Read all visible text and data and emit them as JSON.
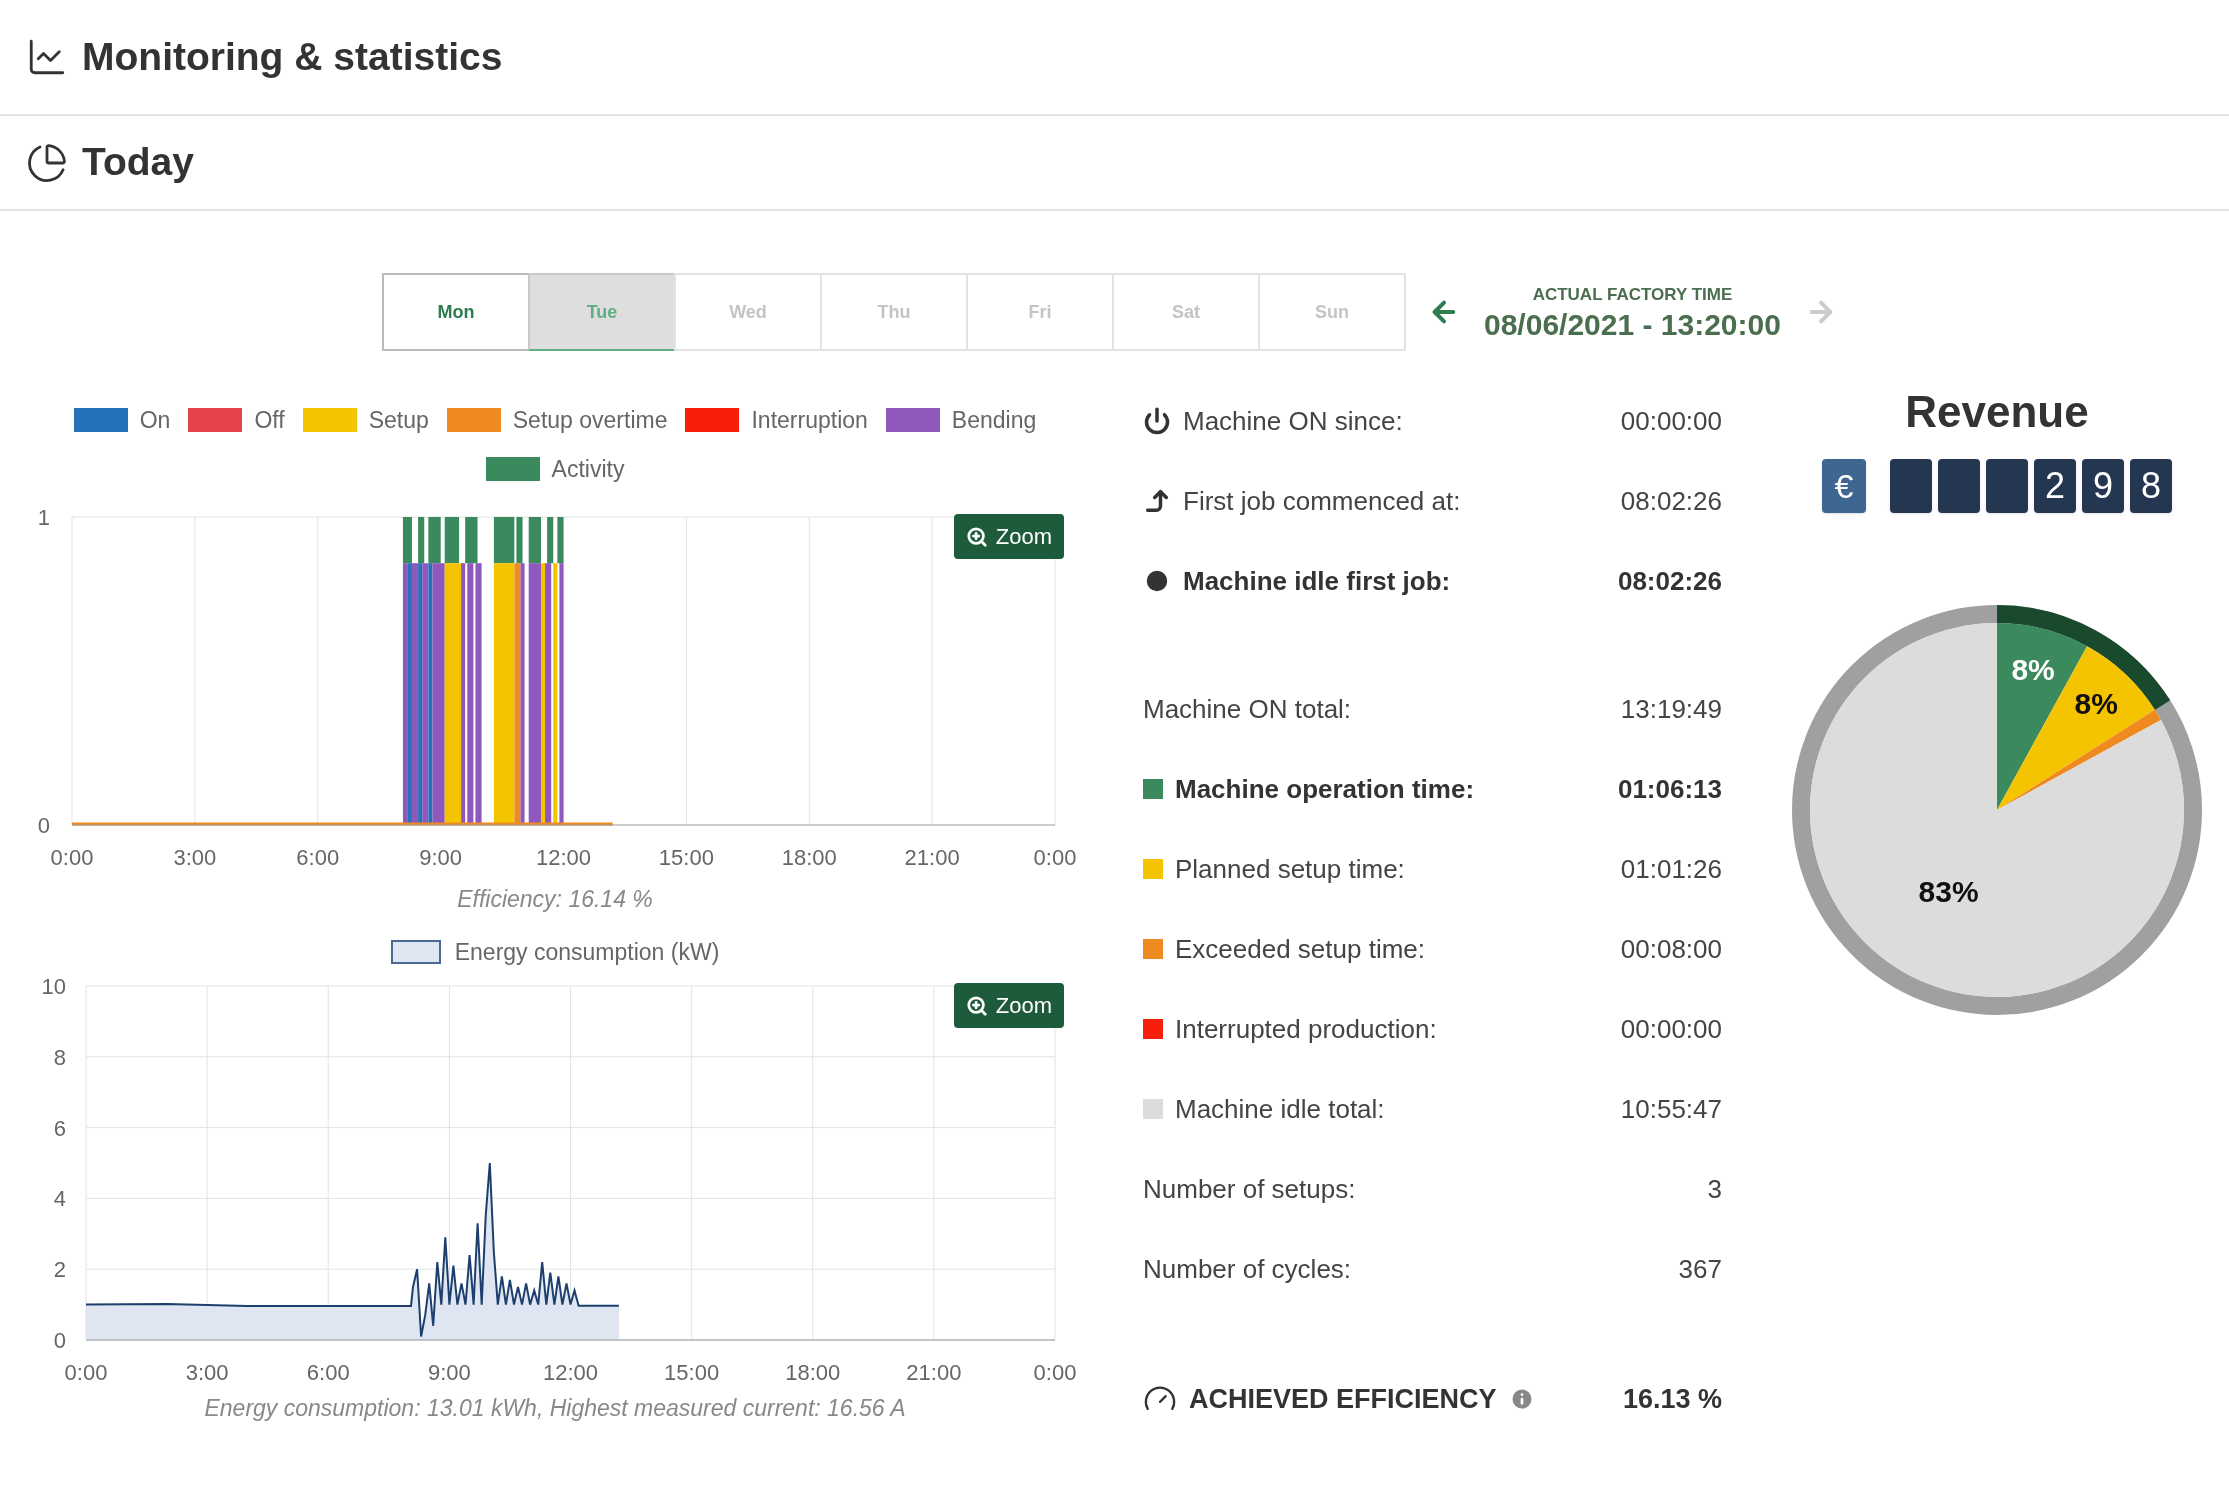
{
  "header": {
    "title": "Monitoring & statistics"
  },
  "section": {
    "title": "Today"
  },
  "days": [
    {
      "label": "Mon",
      "selected": false,
      "disabled": false
    },
    {
      "label": "Tue",
      "selected": true,
      "disabled": false
    },
    {
      "label": "Wed",
      "selected": false,
      "disabled": true
    },
    {
      "label": "Thu",
      "selected": false,
      "disabled": true
    },
    {
      "label": "Fri",
      "selected": false,
      "disabled": true
    },
    {
      "label": "Sat",
      "selected": false,
      "disabled": true
    },
    {
      "label": "Sun",
      "selected": false,
      "disabled": true
    }
  ],
  "factory_time": {
    "label": "ACTUAL FACTORY TIME",
    "value": "08/06/2021 - 13:20:00",
    "prev_disabled": false,
    "next_disabled": true
  },
  "state_chart": {
    "legend": [
      {
        "label": "On",
        "color": "#2473b8"
      },
      {
        "label": "Off",
        "color": "#e5434b"
      },
      {
        "label": "Setup",
        "color": "#f5c400"
      },
      {
        "label": "Setup overtime",
        "color": "#ee8a1f"
      },
      {
        "label": "Interruption",
        "color": "#f71f0b"
      },
      {
        "label": "Bending",
        "color": "#8e58bd"
      },
      {
        "label": "Activity",
        "color": "#3a8a5e"
      }
    ],
    "y_ticks": [
      "1",
      "0"
    ],
    "x_ticks": [
      "0:00",
      "3:00",
      "6:00",
      "9:00",
      "12:00",
      "15:00",
      "18:00",
      "21:00",
      "0:00"
    ],
    "zoom_button": "Zoom",
    "caption": "Efficiency: 16.14 %"
  },
  "energy_chart": {
    "zoom_button": "Zoom",
    "caption": "Energy consumption: 13.01 kWh, Highest measured current: 16.56 A",
    "chart_data": {
      "type": "area",
      "x": [
        0,
        2,
        4,
        8.05,
        8.1,
        8.2,
        8.3,
        8.4,
        8.5,
        8.6,
        8.7,
        8.8,
        8.9,
        9.0,
        9.1,
        9.2,
        9.3,
        9.4,
        9.5,
        9.6,
        9.7,
        9.8,
        9.9,
        10.0,
        10.1,
        10.2,
        10.3,
        10.4,
        10.5,
        10.6,
        10.7,
        10.8,
        10.9,
        11.0,
        11.1,
        11.2,
        11.3,
        11.4,
        11.5,
        11.6,
        11.7,
        11.8,
        11.9,
        12.0,
        12.1,
        12.2,
        13.2
      ],
      "series": [
        {
          "name": "Energy consumption (kW)",
          "color": "#1d3f6e",
          "values": [
            1.0,
            1.02,
            0.96,
            0.96,
            1.5,
            2.0,
            0.1,
            0.7,
            1.6,
            0.4,
            2.2,
            1.0,
            2.9,
            1.0,
            2.1,
            1.0,
            1.6,
            1.0,
            2.4,
            1.0,
            3.3,
            1.0,
            3.5,
            5.0,
            2.5,
            1.0,
            1.8,
            1.0,
            1.7,
            1.0,
            1.5,
            1.0,
            1.6,
            1.0,
            1.4,
            1.0,
            2.2,
            1.0,
            1.9,
            1.0,
            1.8,
            1.0,
            1.6,
            1.0,
            1.4,
            0.97,
            0.97
          ]
        }
      ],
      "xlim": [
        0,
        24
      ],
      "ylim": [
        0,
        10
      ],
      "xticks": [
        {
          "value": 0,
          "label": "0:00"
        },
        {
          "value": 3,
          "label": "3:00"
        },
        {
          "value": 6,
          "label": "6:00"
        },
        {
          "value": 9,
          "label": "9:00"
        },
        {
          "value": 12,
          "label": "12:00"
        },
        {
          "value": 15,
          "label": "15:00"
        },
        {
          "value": 18,
          "label": "18:00"
        },
        {
          "value": 21,
          "label": "21:00"
        },
        {
          "value": 24,
          "label": "0:00"
        }
      ],
      "yticks": [
        0,
        2,
        4,
        6,
        8,
        10
      ],
      "grid": true
    }
  },
  "stats_top": [
    {
      "kind": "power",
      "label": "Machine ON since:",
      "value": "00:00:00",
      "bold": false
    },
    {
      "kind": "start",
      "label": "First job commenced at:",
      "value": "08:02:26",
      "bold": false
    },
    {
      "kind": "idle",
      "label": "Machine idle first job:",
      "value": "08:02:26",
      "bold": true
    }
  ],
  "stats_main": [
    {
      "kind": "plain",
      "label": "Machine ON total:",
      "value": "13:19:49",
      "bold": false
    },
    {
      "kind": "swatch",
      "label": "Machine operation time:",
      "value": "01:06:13",
      "bold": true,
      "color": "#3a8a5e"
    },
    {
      "kind": "swatch",
      "label": "Planned setup time:",
      "value": "01:01:26",
      "bold": false,
      "color": "#f5c400"
    },
    {
      "kind": "swatch",
      "label": "Exceeded setup time:",
      "value": "00:08:00",
      "bold": false,
      "color": "#ee8a1f"
    },
    {
      "kind": "swatch",
      "label": "Interrupted production:",
      "value": "00:00:00",
      "bold": false,
      "color": "#f71f0b"
    },
    {
      "kind": "swatch",
      "label": "Machine idle total:",
      "value": "10:55:47",
      "bold": false,
      "color": "#dcdcdc"
    },
    {
      "kind": "plain",
      "label": "Number of setups:",
      "value": "3",
      "bold": false
    },
    {
      "kind": "plain",
      "label": "Number of cycles:",
      "value": "367",
      "bold": false
    }
  ],
  "efficiency": {
    "label": "ACHIEVED EFFICIENCY",
    "value": "16.13 %"
  },
  "revenue": {
    "title": "Revenue",
    "currency": "€",
    "cells": [
      {
        "kind": "blank"
      },
      {
        "kind": "blank"
      },
      {
        "kind": "blank"
      },
      {
        "kind": "digit",
        "text": "2"
      },
      {
        "kind": "digit",
        "text": "9"
      },
      {
        "kind": "digit",
        "text": "8"
      }
    ]
  },
  "pie": {
    "chart_data": {
      "type": "pie",
      "series": [
        {
          "values": [
            8,
            8,
            1,
            83
          ]
        }
      ],
      "colors": [
        "#3a8a5e",
        "#f5c400",
        "#ee8a1f",
        "#dcdcdc"
      ],
      "value_labels": [
        "8%",
        "8%",
        null,
        "83%"
      ]
    }
  }
}
